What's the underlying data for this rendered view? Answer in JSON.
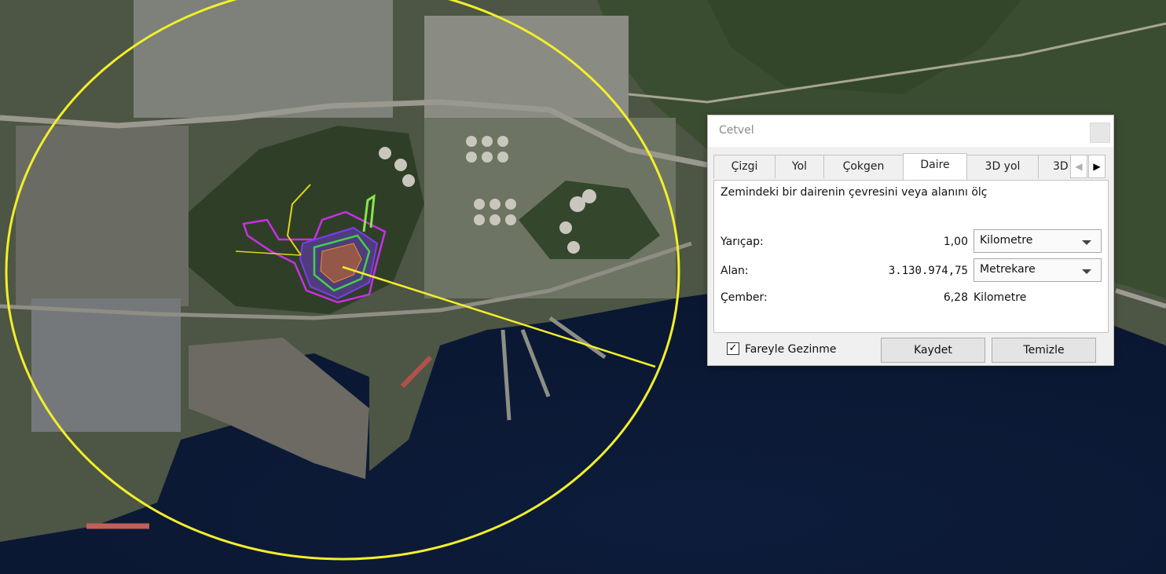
{
  "map": {
    "view": "satellite-imagery",
    "measurement_circle_color": "#f2ef2a",
    "overlay_colors": [
      "#c830e6",
      "#7a3cf0",
      "#3fd24a",
      "#e2d31e"
    ]
  },
  "dialog": {
    "title": "Cetvel",
    "tabs": [
      {
        "label": "Çizgi",
        "active": false
      },
      {
        "label": "Yol",
        "active": false
      },
      {
        "label": "Çokgen",
        "active": false
      },
      {
        "label": "Daire",
        "active": true
      },
      {
        "label": "3D yol",
        "active": false
      },
      {
        "label": "3D",
        "active": false
      }
    ],
    "description": "Zemindeki bir dairenin çevresini veya alanını ölç",
    "rows": {
      "radius": {
        "label": "Yarıçap:",
        "value": "1,00",
        "unit": "Kilometre"
      },
      "area": {
        "label": "Alan:",
        "value": "3.130.974,75",
        "unit": "Metrekare"
      },
      "circumference": {
        "label": "Çember:",
        "value": "6,28",
        "unit": "Kilometre"
      }
    },
    "mouse_navigation": {
      "label": "Fareyle Gezinme",
      "checked": true,
      "check_glyph": "✓"
    },
    "save_label": "Kaydet",
    "clear_label": "Temizle",
    "scroll_left_glyph": "◀",
    "scroll_right_glyph": "▶"
  }
}
